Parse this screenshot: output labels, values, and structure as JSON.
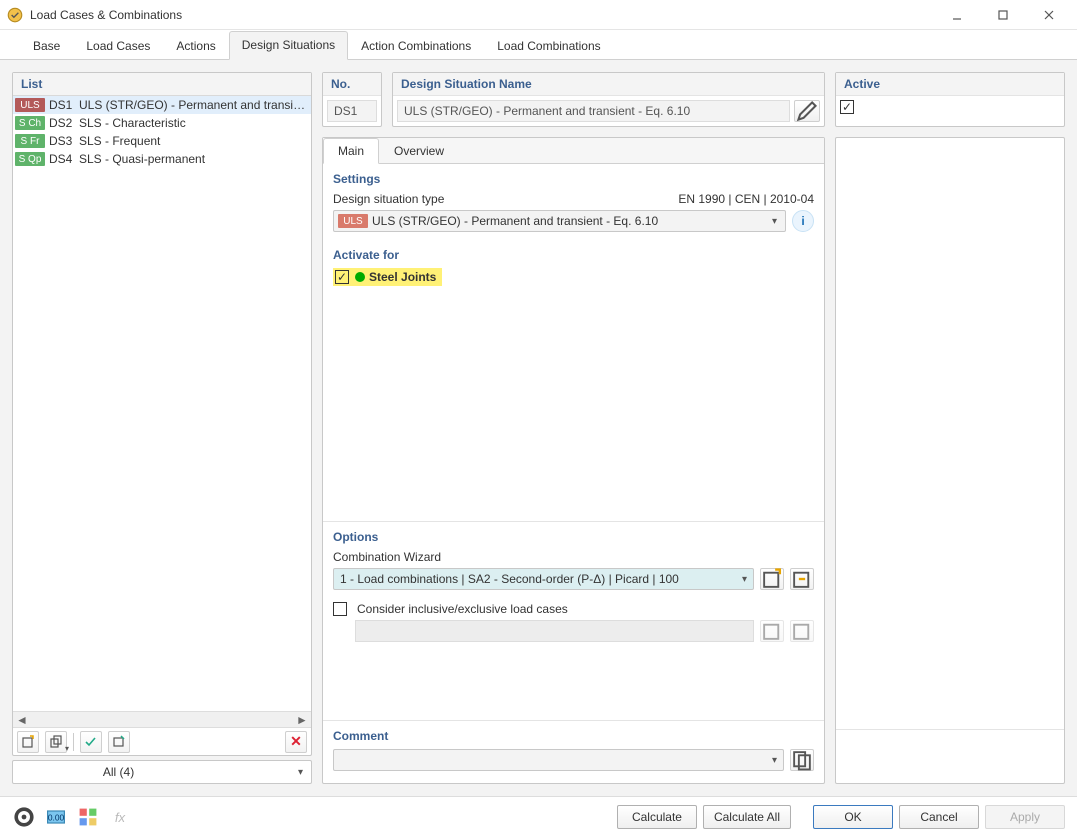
{
  "window": {
    "title": "Load Cases & Combinations"
  },
  "tabs": [
    "Base",
    "Load Cases",
    "Actions",
    "Design Situations",
    "Action Combinations",
    "Load Combinations"
  ],
  "activeTab": "Design Situations",
  "list": {
    "header": "List",
    "items": [
      {
        "badge": "ULS",
        "badgeClass": "uls",
        "code": "DS1",
        "name": "ULS (STR/GEO) - Permanent and transient - E",
        "selected": true
      },
      {
        "badge": "S Ch",
        "badgeClass": "sch",
        "code": "DS2",
        "name": "SLS - Characteristic"
      },
      {
        "badge": "S Fr",
        "badgeClass": "sfr",
        "code": "DS3",
        "name": "SLS - Frequent"
      },
      {
        "badge": "S Qp",
        "badgeClass": "sqp",
        "code": "DS4",
        "name": "SLS - Quasi-permanent"
      }
    ],
    "filter": "All (4)"
  },
  "header": {
    "noLabel": "No.",
    "noValue": "DS1",
    "nameLabel": "Design Situation Name",
    "nameValue": "ULS (STR/GEO) - Permanent and transient - Eq. 6.10",
    "activeLabel": "Active",
    "activeChecked": true
  },
  "detailTabs": [
    "Main",
    "Overview"
  ],
  "activeDetailTab": "Main",
  "settings": {
    "title": "Settings",
    "typeLabel": "Design situation type",
    "standard": "EN 1990 | CEN | 2010-04",
    "typeBadge": "ULS",
    "typeValue": "ULS (STR/GEO) - Permanent and transient - Eq. 6.10"
  },
  "activate": {
    "title": "Activate for",
    "items": [
      {
        "label": "Steel Joints",
        "checked": true
      }
    ]
  },
  "options": {
    "title": "Options",
    "wizardLabel": "Combination Wizard",
    "wizardValue": "1 - Load combinations | SA2 - Second-order (P-Δ) | Picard | 100",
    "considerLabel": "Consider inclusive/exclusive load cases",
    "considerChecked": false
  },
  "comment": {
    "title": "Comment",
    "value": ""
  },
  "footer": {
    "calculate": "Calculate",
    "calculateAll": "Calculate All",
    "ok": "OK",
    "cancel": "Cancel",
    "apply": "Apply"
  }
}
